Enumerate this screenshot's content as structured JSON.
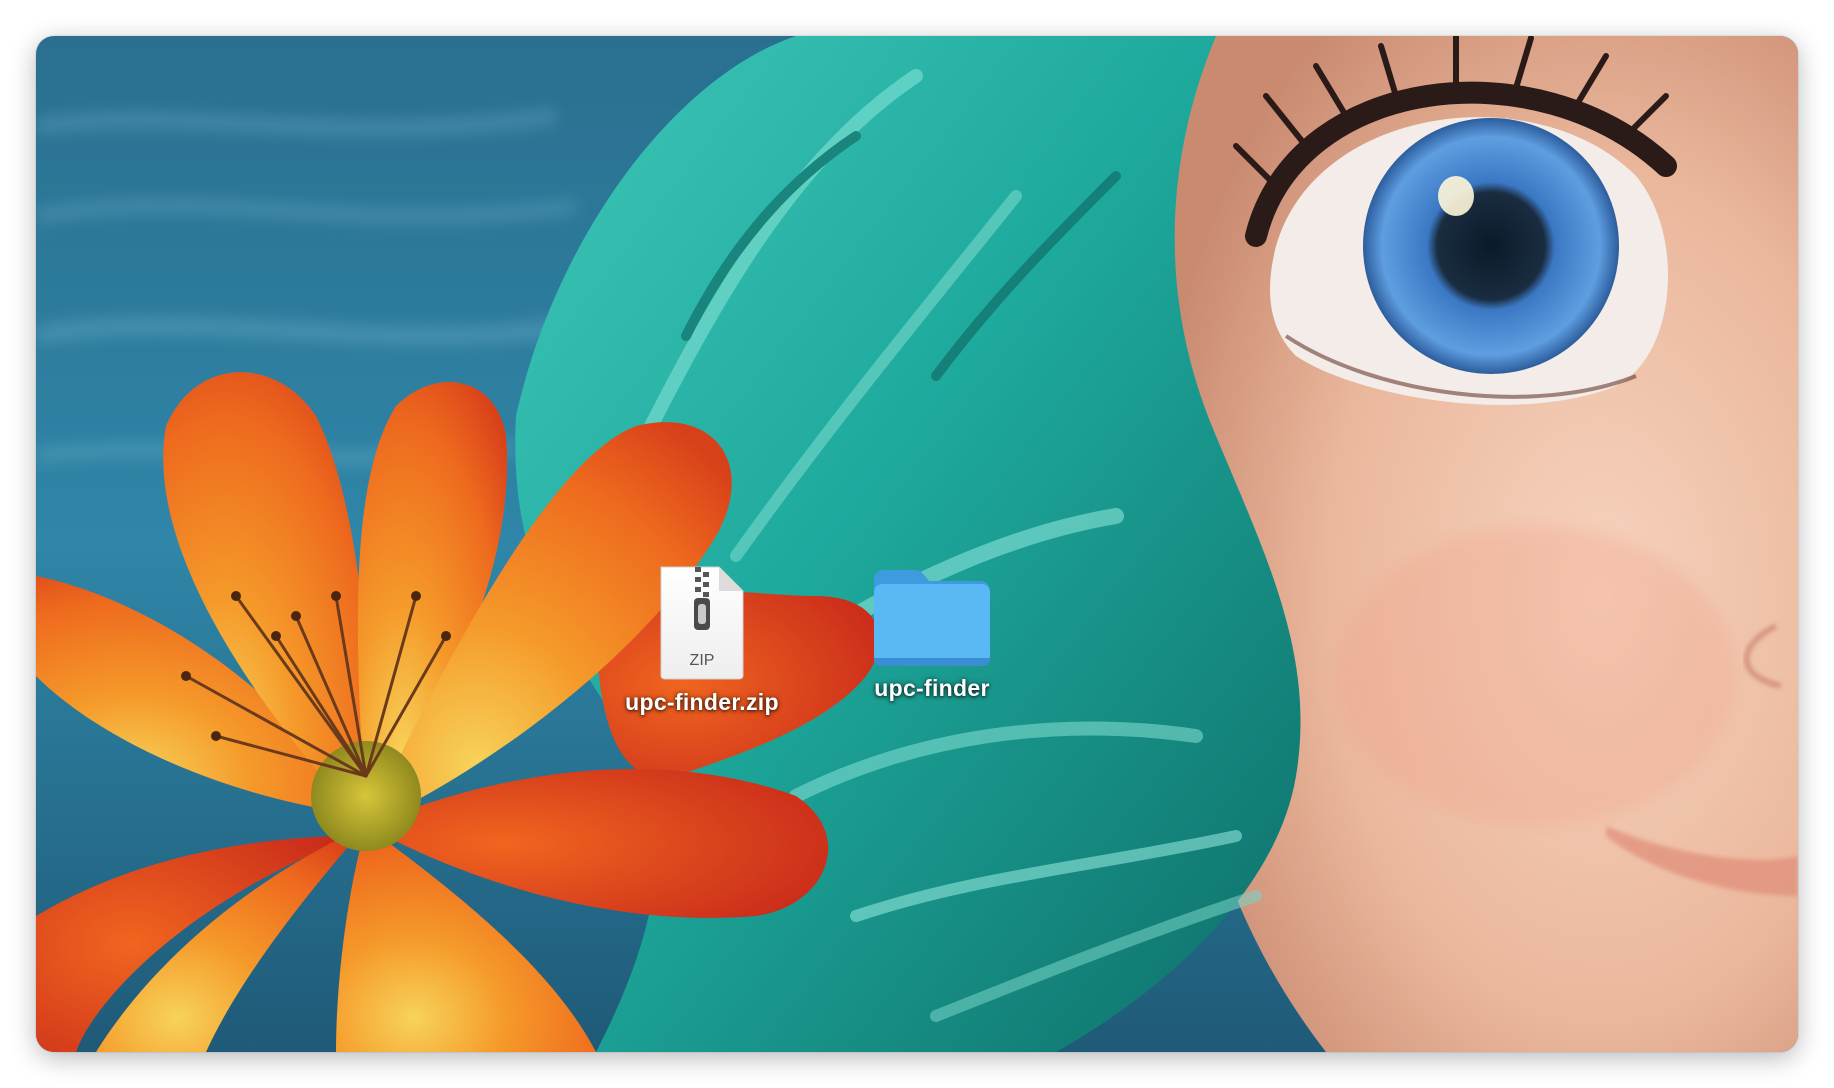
{
  "desktop": {
    "items": [
      {
        "label": "upc-finder.zip",
        "type": "zip-archive",
        "icon": "zip-file-icon",
        "badge": "ZIP"
      },
      {
        "label": "upc-finder",
        "type": "folder",
        "icon": "folder-icon"
      }
    ]
  },
  "colors": {
    "folder_blue": "#5ab8f5",
    "label_text": "#ffffff"
  }
}
